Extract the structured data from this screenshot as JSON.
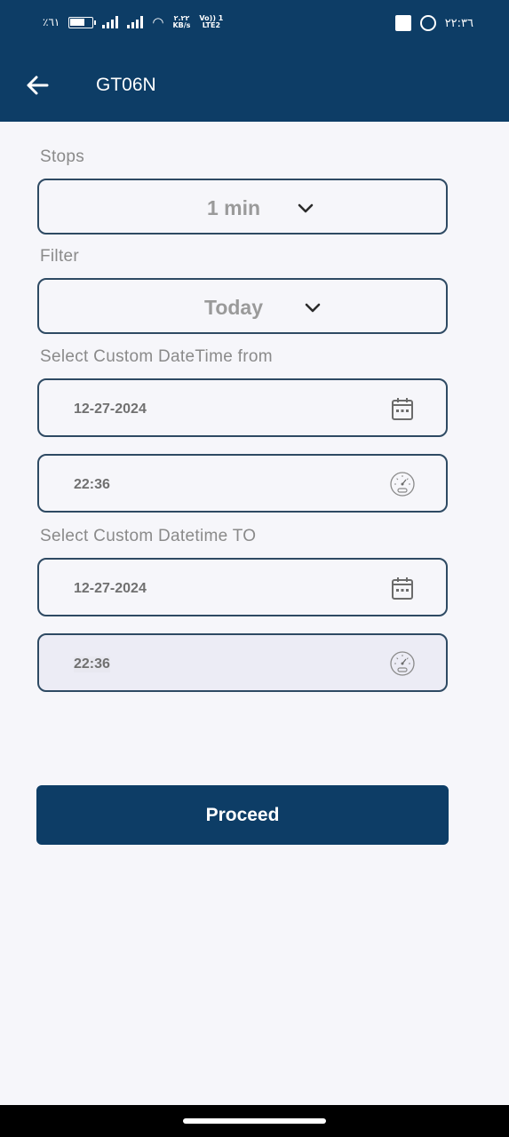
{
  "status_bar": {
    "battery_percent": "٪٦١",
    "speed_value": "٢.٢٢",
    "speed_unit": "KB/s",
    "volte_top": "Vo)) 1",
    "volte_bottom": "LTE2",
    "time": "٢٢:٣٦"
  },
  "app_bar": {
    "title": "GT06N"
  },
  "stops": {
    "label": "Stops",
    "value": "1 min"
  },
  "filter": {
    "label": "Filter",
    "value": "Today"
  },
  "from": {
    "label": "Select Custom DateTime from",
    "date": "12-27-2024",
    "time": "22:36"
  },
  "to": {
    "label": "Select Custom Datetime TO",
    "date": "12-27-2024",
    "time": "22:36"
  },
  "proceed_label": "Proceed",
  "colors": {
    "primary": "#0d3d66",
    "field_border": "#2e4a63",
    "background": "#f6f6fa",
    "label_text": "#8a8a8a"
  },
  "icons": [
    "back-arrow-icon",
    "chevron-down-icon",
    "calendar-icon",
    "clock-dial-icon"
  ]
}
